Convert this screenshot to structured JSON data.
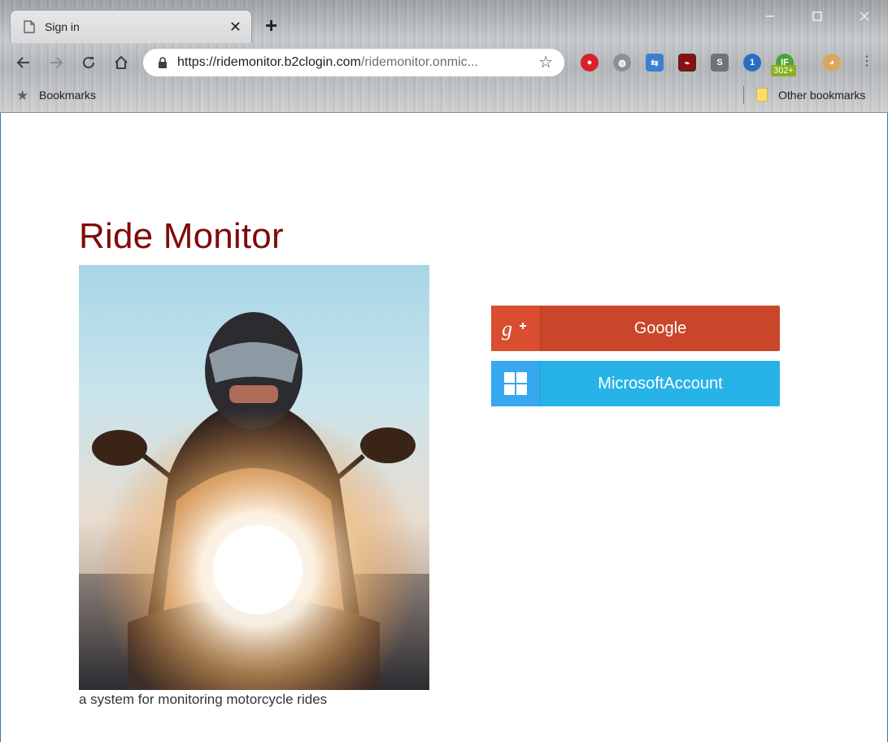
{
  "browser": {
    "tab_title": "Sign in",
    "url_host": "https://ridemonitor.b2clogin.com",
    "url_rest": "/ridemonitor.onmic...",
    "bookmarks_label": "Bookmarks",
    "other_bookmarks_label": "Other bookmarks",
    "extension_badge": "302+"
  },
  "page": {
    "title": "Ride Monitor",
    "caption": "a system for monitoring motorcycle rides",
    "title_color": "#7f0a0a"
  },
  "providers": [
    {
      "label": "Google",
      "icon": "google-plus-icon",
      "color": "#c9462b"
    },
    {
      "label": "MicrosoftAccount",
      "icon": "windows-logo-icon",
      "color": "#27b3e8"
    }
  ]
}
